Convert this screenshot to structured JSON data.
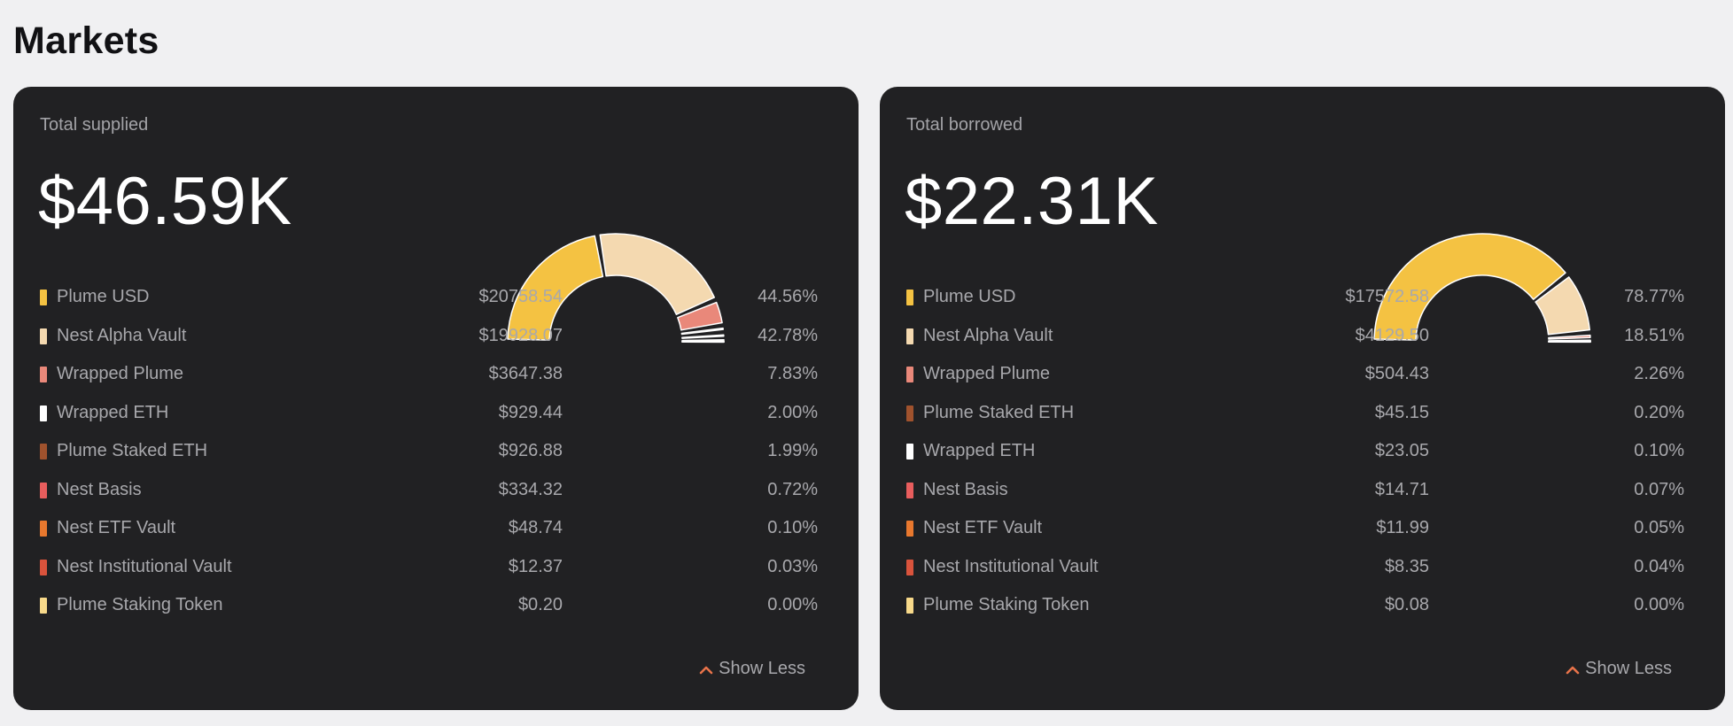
{
  "page": {
    "title": "Markets"
  },
  "colors": {
    "background": "#f0f0f2",
    "card": "#212123",
    "accent": "#e8734a"
  },
  "cards": [
    {
      "label": "Total supplied",
      "total": "$46.59K",
      "toggle_label": "Show Less",
      "toggle_icon": "chevron-up-icon",
      "items": [
        {
          "name": "Plume USD",
          "value": "$20758.54",
          "pct": "44.56%",
          "color": "#f4c242"
        },
        {
          "name": "Nest Alpha Vault",
          "value": "$19928.07",
          "pct": "42.78%",
          "color": "#f4d9b0"
        },
        {
          "name": "Wrapped Plume",
          "value": "$3647.38",
          "pct": "7.83%",
          "color": "#e9887a"
        },
        {
          "name": "Wrapped ETH",
          "value": "$929.44",
          "pct": "2.00%",
          "color": "#ffffff"
        },
        {
          "name": "Plume Staked ETH",
          "value": "$926.88",
          "pct": "1.99%",
          "color": "#a0522d"
        },
        {
          "name": "Nest Basis",
          "value": "$334.32",
          "pct": "0.72%",
          "color": "#e85d5d"
        },
        {
          "name": "Nest ETF Vault",
          "value": "$48.74",
          "pct": "0.10%",
          "color": "#e8782e"
        },
        {
          "name": "Nest Institutional Vault",
          "value": "$12.37",
          "pct": "0.03%",
          "color": "#d9533c"
        },
        {
          "name": "Plume Staking Token",
          "value": "$0.20",
          "pct": "0.00%",
          "color": "#f7d98a"
        }
      ]
    },
    {
      "label": "Total borrowed",
      "total": "$22.31K",
      "toggle_label": "Show Less",
      "toggle_icon": "chevron-up-icon",
      "items": [
        {
          "name": "Plume USD",
          "value": "$17572.58",
          "pct": "78.77%",
          "color": "#f4c242"
        },
        {
          "name": "Nest Alpha Vault",
          "value": "$4129.50",
          "pct": "18.51%",
          "color": "#f4d9b0"
        },
        {
          "name": "Wrapped Plume",
          "value": "$504.43",
          "pct": "2.26%",
          "color": "#e9887a"
        },
        {
          "name": "Plume Staked ETH",
          "value": "$45.15",
          "pct": "0.20%",
          "color": "#a0522d"
        },
        {
          "name": "Wrapped ETH",
          "value": "$23.05",
          "pct": "0.10%",
          "color": "#ffffff"
        },
        {
          "name": "Nest Basis",
          "value": "$14.71",
          "pct": "0.07%",
          "color": "#e85d5d"
        },
        {
          "name": "Nest ETF Vault",
          "value": "$11.99",
          "pct": "0.05%",
          "color": "#e8782e"
        },
        {
          "name": "Nest Institutional Vault",
          "value": "$8.35",
          "pct": "0.04%",
          "color": "#d9533c"
        },
        {
          "name": "Plume Staking Token",
          "value": "$0.08",
          "pct": "0.00%",
          "color": "#f7d98a"
        }
      ]
    }
  ]
}
